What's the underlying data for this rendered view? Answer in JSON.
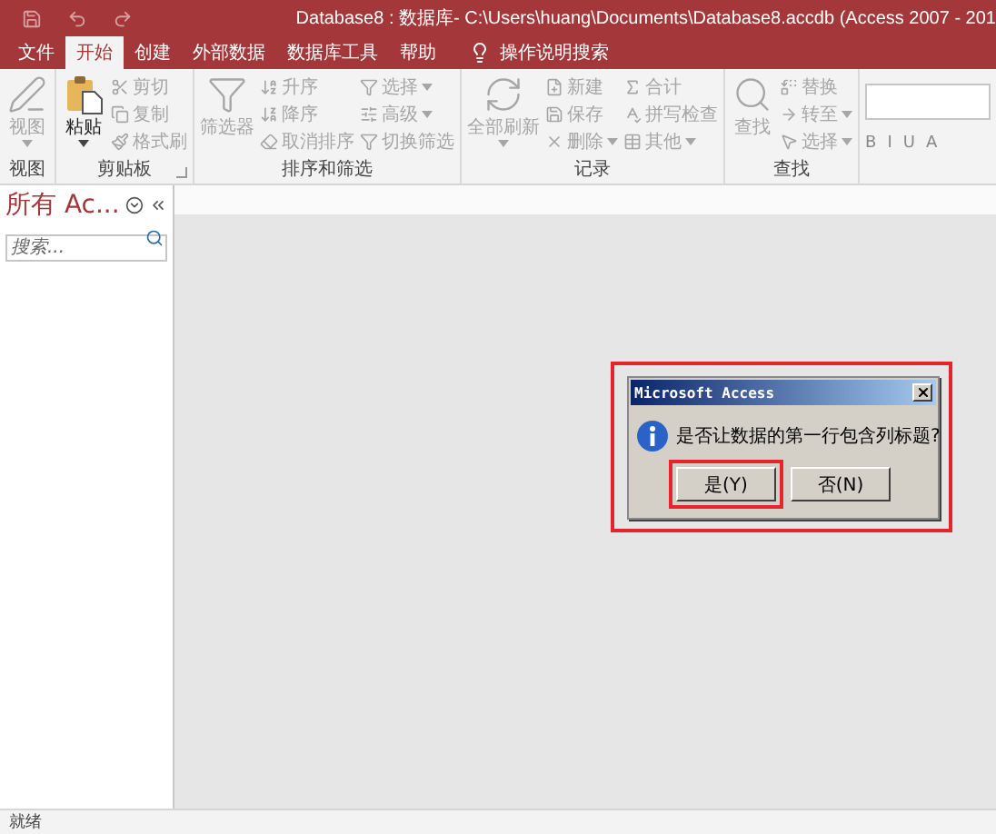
{
  "window": {
    "title": "Database8 : 数据库- C:\\Users\\huang\\Documents\\Database8.accdb (Access 2007 - 201"
  },
  "tabs": [
    {
      "label": "文件",
      "selected": false
    },
    {
      "label": "开始",
      "selected": true
    },
    {
      "label": "创建",
      "selected": false
    },
    {
      "label": "外部数据",
      "selected": false
    },
    {
      "label": "数据库工具",
      "selected": false
    },
    {
      "label": "帮助",
      "selected": false
    }
  ],
  "tell_me": "操作说明搜索",
  "ribbon": {
    "groups": [
      {
        "label": "视图",
        "large": [
          {
            "label": "视图",
            "caret": true,
            "disabled": true
          }
        ],
        "launcher": false
      },
      {
        "label": "剪贴板",
        "large": [
          {
            "label": "粘贴",
            "caret": true,
            "disabled": false
          }
        ],
        "columns": [
          [
            {
              "label": "剪切",
              "caret": false,
              "disabled": true
            },
            {
              "label": "复制",
              "caret": false,
              "disabled": true
            },
            {
              "label": "格式刷",
              "caret": false,
              "disabled": true
            }
          ]
        ],
        "launcher": true
      },
      {
        "label": "排序和筛选",
        "large": [
          {
            "label": "筛选器",
            "caret": false,
            "disabled": true
          }
        ],
        "columns": [
          [
            {
              "label": "升序",
              "caret": false,
              "disabled": true
            },
            {
              "label": "降序",
              "caret": false,
              "disabled": true
            },
            {
              "label": "取消排序",
              "caret": false,
              "disabled": true
            }
          ],
          [
            {
              "label": "选择",
              "caret": true,
              "disabled": true
            },
            {
              "label": "高级",
              "caret": true,
              "disabled": true
            },
            {
              "label": "切换筛选",
              "caret": false,
              "disabled": true
            }
          ]
        ],
        "launcher": false
      },
      {
        "label": "记录",
        "large": [
          {
            "label": "全部刷新",
            "caret": true,
            "disabled": true
          }
        ],
        "columns": [
          [
            {
              "label": "新建",
              "caret": false,
              "disabled": true
            },
            {
              "label": "保存",
              "caret": false,
              "disabled": true
            },
            {
              "label": "删除",
              "caret": true,
              "disabled": true
            }
          ],
          [
            {
              "label": "合计",
              "caret": false,
              "disabled": true
            },
            {
              "label": "拼写检查",
              "caret": false,
              "disabled": true
            },
            {
              "label": "其他",
              "caret": true,
              "disabled": true
            }
          ]
        ],
        "launcher": false
      },
      {
        "label": "查找",
        "large": [
          {
            "label": "查找",
            "caret": false,
            "disabled": true
          }
        ],
        "columns": [
          [
            {
              "label": "替换",
              "caret": false,
              "disabled": true
            },
            {
              "label": "转至",
              "caret": true,
              "disabled": true
            },
            {
              "label": "选择",
              "caret": true,
              "disabled": true
            }
          ]
        ],
        "launcher": false
      }
    ],
    "format": {
      "buttons": [
        "B",
        "I",
        "U",
        "A"
      ]
    }
  },
  "nav_pane": {
    "title": "所有 Ac...",
    "search": {
      "placeholder": "搜索..."
    }
  },
  "dialog": {
    "title": "Microsoft Access",
    "message": "是否让数据的第一行包含列标题?",
    "buttons": [
      {
        "label": "是(Y)",
        "highlighted": true
      },
      {
        "label": "否(N)",
        "highlighted": false
      }
    ]
  },
  "status_bar": "就绪"
}
